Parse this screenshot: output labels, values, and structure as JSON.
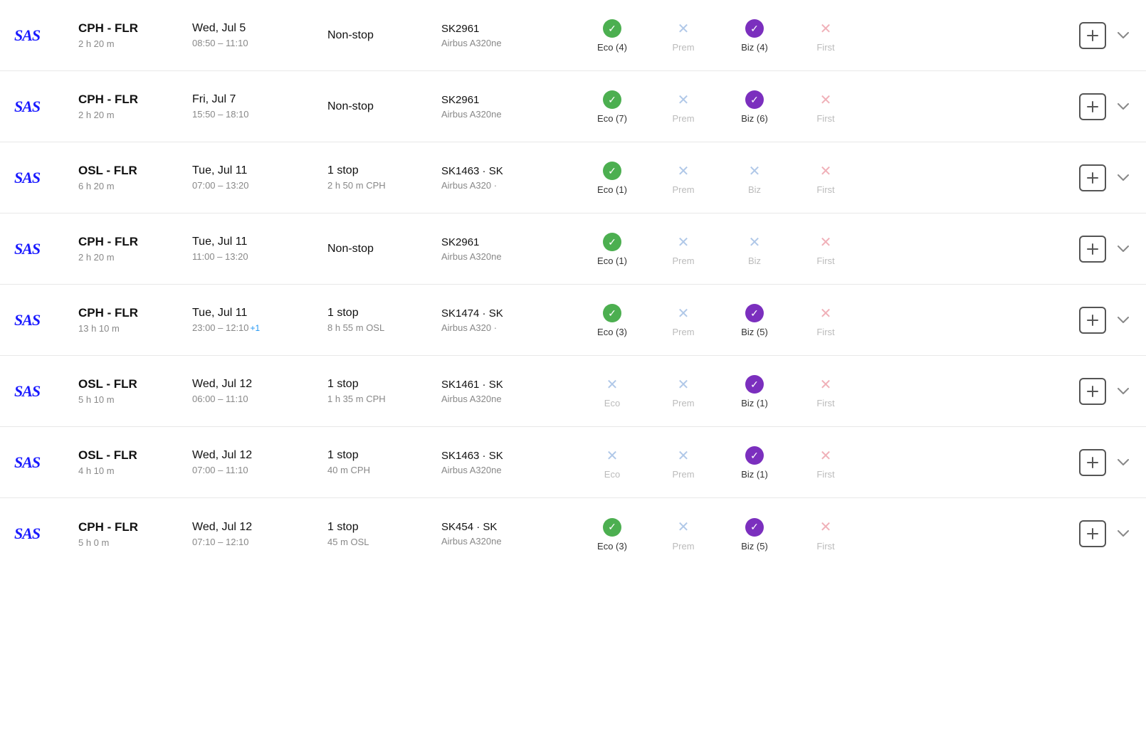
{
  "flights": [
    {
      "id": "f1",
      "logo": "SAS",
      "route": "CPH - FLR",
      "duration": "2 h 20 m",
      "date": "Wed, Jul 5",
      "time": "08:50 – 11:10",
      "plusDay": null,
      "stops": "Non-stop",
      "stopsDetail": null,
      "flightNumber": "SK2961",
      "aircraft": "Airbus A320ne",
      "eco": {
        "available": true,
        "label": "Eco (4)"
      },
      "prem": {
        "available": false,
        "label": "Prem"
      },
      "biz": {
        "available": true,
        "label": "Biz (4)"
      },
      "first": {
        "available": false,
        "label": "First"
      }
    },
    {
      "id": "f2",
      "logo": "SAS",
      "route": "CPH - FLR",
      "duration": "2 h 20 m",
      "date": "Fri, Jul 7",
      "time": "15:50 – 18:10",
      "plusDay": null,
      "stops": "Non-stop",
      "stopsDetail": null,
      "flightNumber": "SK2961",
      "aircraft": "Airbus A320ne",
      "eco": {
        "available": true,
        "label": "Eco (7)"
      },
      "prem": {
        "available": false,
        "label": "Prem"
      },
      "biz": {
        "available": true,
        "label": "Biz (6)"
      },
      "first": {
        "available": false,
        "label": "First"
      }
    },
    {
      "id": "f3",
      "logo": "SAS",
      "route": "OSL - FLR",
      "duration": "6 h 20 m",
      "date": "Tue, Jul 11",
      "time": "07:00 – 13:20",
      "plusDay": null,
      "stops": "1 stop",
      "stopsDetail": "2 h 50 m CPH",
      "flightNumber": "SK1463 · SK",
      "aircraft": "Airbus A320 ·",
      "eco": {
        "available": true,
        "label": "Eco (1)"
      },
      "prem": {
        "available": false,
        "label": "Prem"
      },
      "biz": {
        "available": false,
        "label": "Biz"
      },
      "first": {
        "available": false,
        "label": "First"
      }
    },
    {
      "id": "f4",
      "logo": "SAS",
      "route": "CPH - FLR",
      "duration": "2 h 20 m",
      "date": "Tue, Jul 11",
      "time": "11:00 – 13:20",
      "plusDay": null,
      "stops": "Non-stop",
      "stopsDetail": null,
      "flightNumber": "SK2961",
      "aircraft": "Airbus A320ne",
      "eco": {
        "available": true,
        "label": "Eco (1)"
      },
      "prem": {
        "available": false,
        "label": "Prem"
      },
      "biz": {
        "available": false,
        "label": "Biz"
      },
      "first": {
        "available": false,
        "label": "First"
      }
    },
    {
      "id": "f5",
      "logo": "SAS",
      "route": "CPH - FLR",
      "duration": "13 h 10 m",
      "date": "Tue, Jul 11",
      "time": "23:00 – 12:10",
      "plusDay": "+1",
      "stops": "1 stop",
      "stopsDetail": "8 h 55 m OSL",
      "flightNumber": "SK1474 · SK",
      "aircraft": "Airbus A320 ·",
      "eco": {
        "available": true,
        "label": "Eco (3)"
      },
      "prem": {
        "available": false,
        "label": "Prem"
      },
      "biz": {
        "available": true,
        "label": "Biz (5)"
      },
      "first": {
        "available": false,
        "label": "First"
      }
    },
    {
      "id": "f6",
      "logo": "SAS",
      "route": "OSL - FLR",
      "duration": "5 h 10 m",
      "date": "Wed, Jul 12",
      "time": "06:00 – 11:10",
      "plusDay": null,
      "stops": "1 stop",
      "stopsDetail": "1 h 35 m CPH",
      "flightNumber": "SK1461 · SK",
      "aircraft": "Airbus A320ne",
      "eco": {
        "available": false,
        "label": "Eco"
      },
      "prem": {
        "available": false,
        "label": "Prem"
      },
      "biz": {
        "available": true,
        "label": "Biz (1)"
      },
      "first": {
        "available": false,
        "label": "First"
      }
    },
    {
      "id": "f7",
      "logo": "SAS",
      "route": "OSL - FLR",
      "duration": "4 h 10 m",
      "date": "Wed, Jul 12",
      "time": "07:00 – 11:10",
      "plusDay": null,
      "stops": "1 stop",
      "stopsDetail": "40 m CPH",
      "flightNumber": "SK1463 · SK",
      "aircraft": "Airbus A320ne",
      "eco": {
        "available": false,
        "label": "Eco"
      },
      "prem": {
        "available": false,
        "label": "Prem"
      },
      "biz": {
        "available": true,
        "label": "Biz (1)"
      },
      "first": {
        "available": false,
        "label": "First"
      }
    },
    {
      "id": "f8",
      "logo": "SAS",
      "route": "CPH - FLR",
      "duration": "5 h 0 m",
      "date": "Wed, Jul 12",
      "time": "07:10 – 12:10",
      "plusDay": null,
      "stops": "1 stop",
      "stopsDetail": "45 m OSL",
      "flightNumber": "SK454 · SK",
      "aircraft": "Airbus A320ne",
      "eco": {
        "available": true,
        "label": "Eco (3)"
      },
      "prem": {
        "available": false,
        "label": "Prem"
      },
      "biz": {
        "available": true,
        "label": "Biz (5)"
      },
      "first": {
        "available": false,
        "label": "First"
      }
    }
  ],
  "columns": {
    "add_label": "+",
    "expand_label": "∨"
  }
}
